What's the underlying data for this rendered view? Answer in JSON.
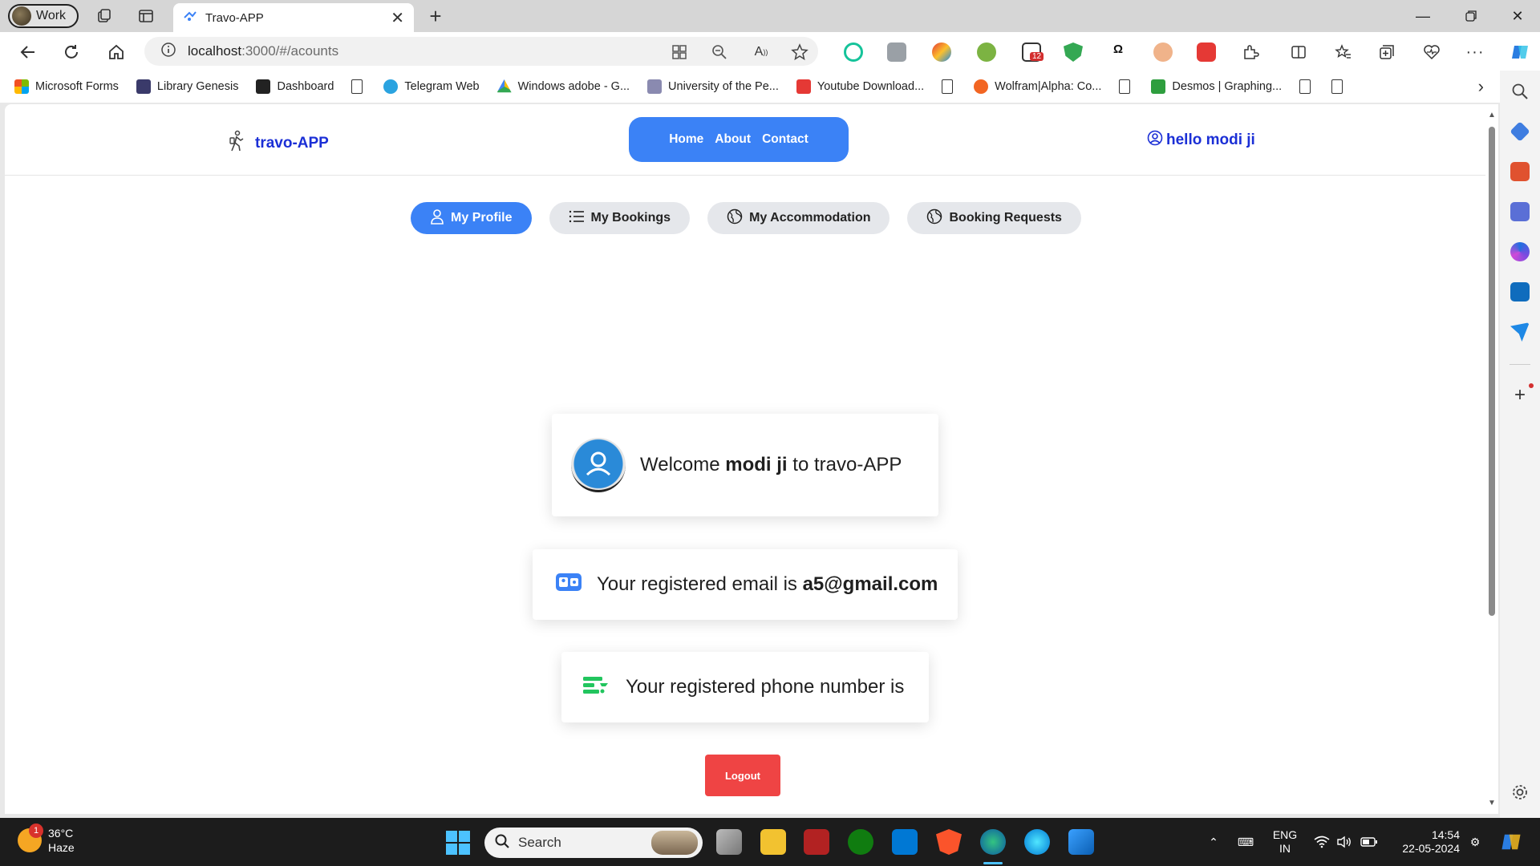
{
  "browser": {
    "profile_label": "Work",
    "tab_title": "Travo-APP",
    "url_host": "localhost",
    "url_rest": ":3000/#/acounts",
    "bookmarks": [
      "Microsoft Forms",
      "Library Genesis",
      "Dashboard",
      "Telegram Web",
      "Windows adobe - G...",
      "University of the Pe...",
      "Youtube Download...",
      "Wolfram|Alpha: Co...",
      "Desmos | Graphing..."
    ],
    "extension_badge": "12"
  },
  "app": {
    "brand": "travo-APP",
    "nav": {
      "home": "Home",
      "about": "About",
      "contact": "Contact"
    },
    "user_greeting": "hello modi ji",
    "tabs": {
      "profile": "My Profile",
      "bookings": "My Bookings",
      "accommodation": "My Accommodation",
      "requests": "Booking Requests"
    },
    "welcome": {
      "prefix": "Welcome",
      "name": "modi ji",
      "suffix": "to travo-APP"
    },
    "email": {
      "prefix": "Your registered email is",
      "value": "a5@gmail.com"
    },
    "phone": {
      "prefix": "Your registered phone number is"
    },
    "logout": "Logout"
  },
  "taskbar": {
    "weather_temp": "36°C",
    "weather_desc": "Haze",
    "weather_badge": "1",
    "search_placeholder": "Search",
    "lang_top": "ENG",
    "lang_bottom": "IN",
    "time": "14:54",
    "date": "22-05-2024"
  },
  "colors": {
    "accent_blue": "#3b82f6",
    "brand_blue": "#1b2fd6",
    "logout_red": "#ef4444"
  }
}
